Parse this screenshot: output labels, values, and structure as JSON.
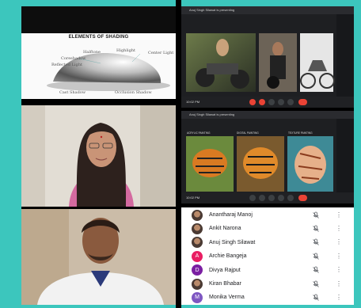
{
  "slide": {
    "title": "ELEMENTS OF SHADING",
    "labels": {
      "highlight": "Highlight",
      "halftone": "Halftone",
      "center_light": "Center Light",
      "core_shadow": "Coreshadow",
      "reflected_light": "Reflected Light",
      "cast_shadow": "Cast Shadow",
      "occlusion_shadow": "Occlusion Shadow"
    }
  },
  "meet1": {
    "title": "Anuj Singh Silawat is presenting",
    "time": "10:02 PM"
  },
  "meet2": {
    "title": "Anuj Singh Silawat is presenting",
    "time": "10:02 PM",
    "panel_labels": [
      "ACRYLIC PAINTING",
      "DIGITAL PAINTING",
      "TEXTURE PAINTING"
    ]
  },
  "participants": [
    {
      "name": "Anantharaj Manoj",
      "initial": "",
      "avatar_color": "",
      "photo": true
    },
    {
      "name": "Ankit Narona",
      "initial": "",
      "avatar_color": "",
      "photo": true
    },
    {
      "name": "Anuj Singh Silawat",
      "initial": "",
      "avatar_color": "",
      "photo": true
    },
    {
      "name": "Archie Bangeja",
      "initial": "A",
      "avatar_color": "#e91e63",
      "photo": false
    },
    {
      "name": "Divya Rajput",
      "initial": "D",
      "avatar_color": "#7b1fa2",
      "photo": false
    },
    {
      "name": "Kiran Bhabar",
      "initial": "",
      "avatar_color": "",
      "photo": true
    },
    {
      "name": "Monika Verma",
      "initial": "M",
      "avatar_color": "#7e57c2",
      "photo": false
    }
  ],
  "colors": {
    "background": "#3cc6bd",
    "end_call": "#ea4335"
  },
  "icons": {
    "muted_mic": "mic-off-icon",
    "more_options": "more-vert-icon"
  }
}
